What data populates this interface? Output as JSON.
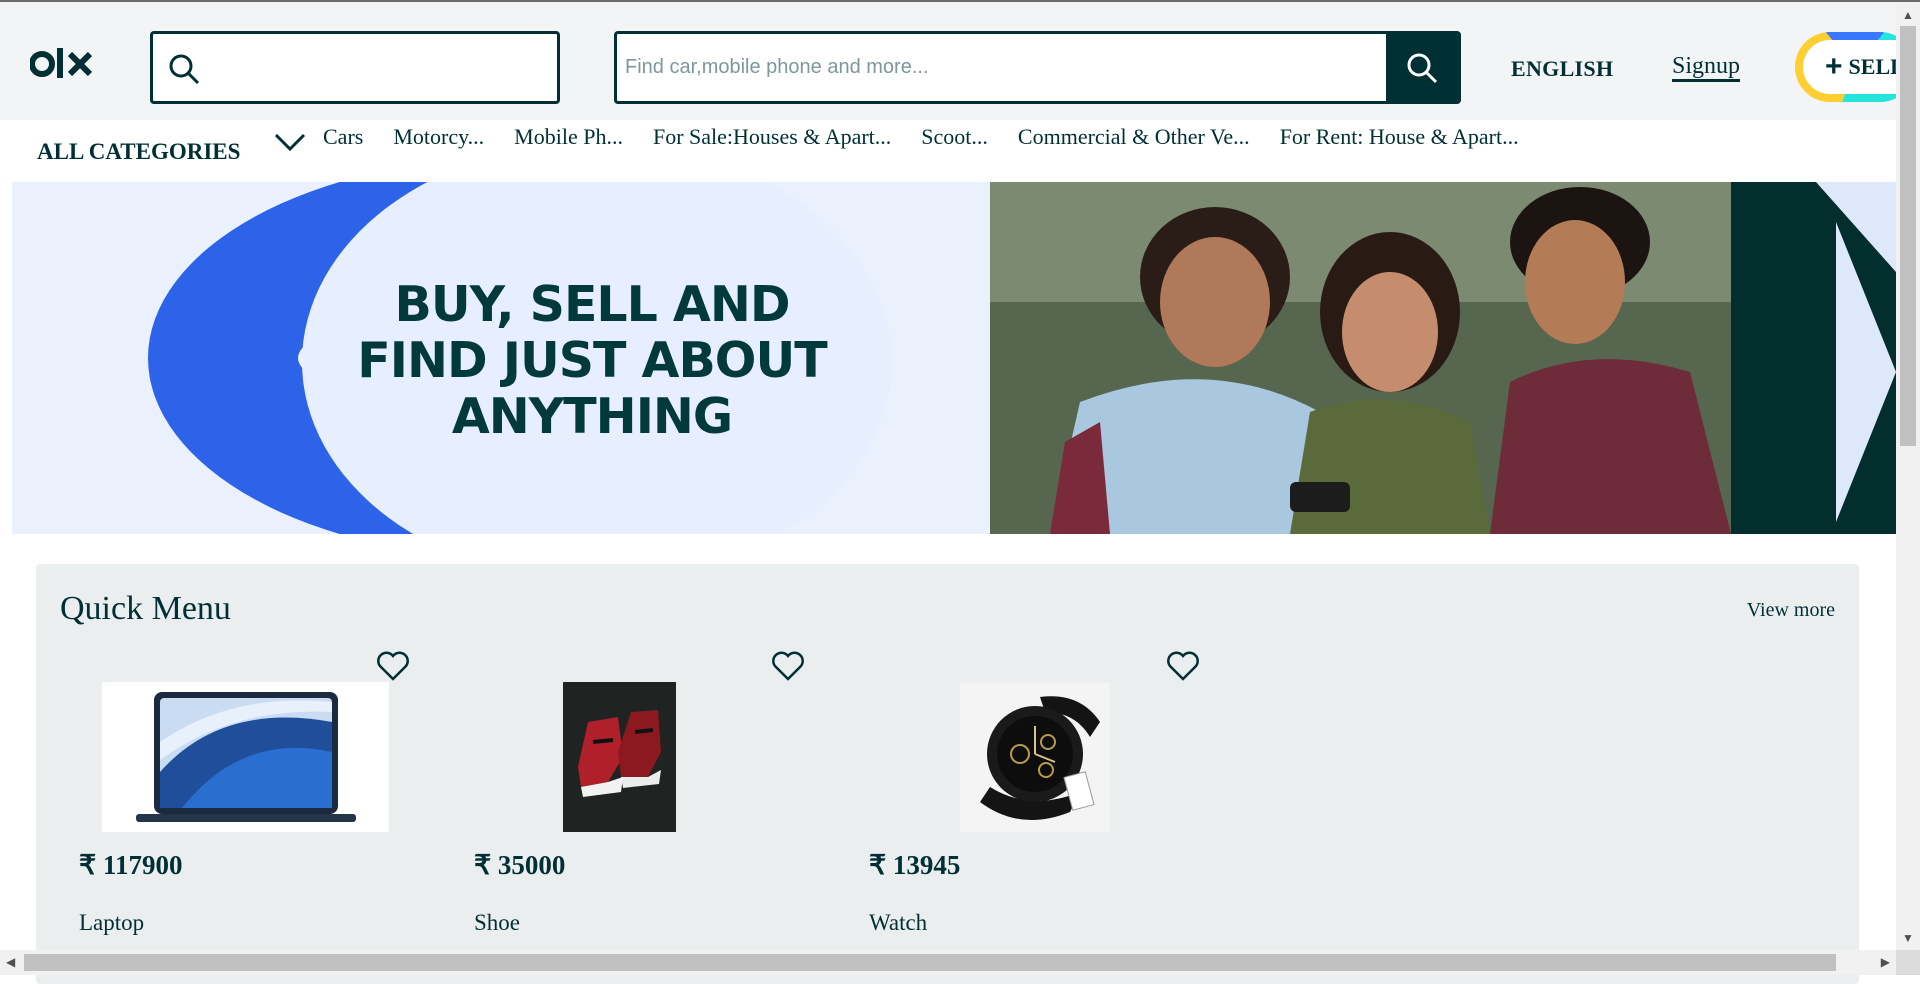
{
  "header": {
    "logo_alt": "OLX",
    "location_placeholder": "",
    "search_placeholder": "Find car,mobile phone and more...",
    "language": "ENGLISH",
    "signup": "Signup",
    "sell_label": "SELL"
  },
  "categories": {
    "all_label": "ALL CATEGORIES",
    "items": [
      "Cars",
      "Motorcy...",
      "Mobile Ph...",
      "For Sale:Houses & Apart...",
      "Scoot...",
      "Commercial & Other Ve...",
      "For Rent: House & Apart..."
    ]
  },
  "banner": {
    "line1": "BUY, SELL AND",
    "line2": "FIND JUST ABOUT",
    "line3": "ANYTHING"
  },
  "quick_menu": {
    "title": "Quick Menu",
    "view_more": "View more",
    "items": [
      {
        "price": "₹ 117900",
        "name": "Laptop",
        "icon": "laptop-image"
      },
      {
        "price": "₹ 35000",
        "name": "Shoe",
        "icon": "shoe-image"
      },
      {
        "price": "₹ 13945",
        "name": "Watch",
        "icon": "watch-image"
      }
    ]
  },
  "colors": {
    "brand_dark": "#002f34",
    "banner_blue": "#2c63e8",
    "panel_bg": "#ebeeef"
  }
}
